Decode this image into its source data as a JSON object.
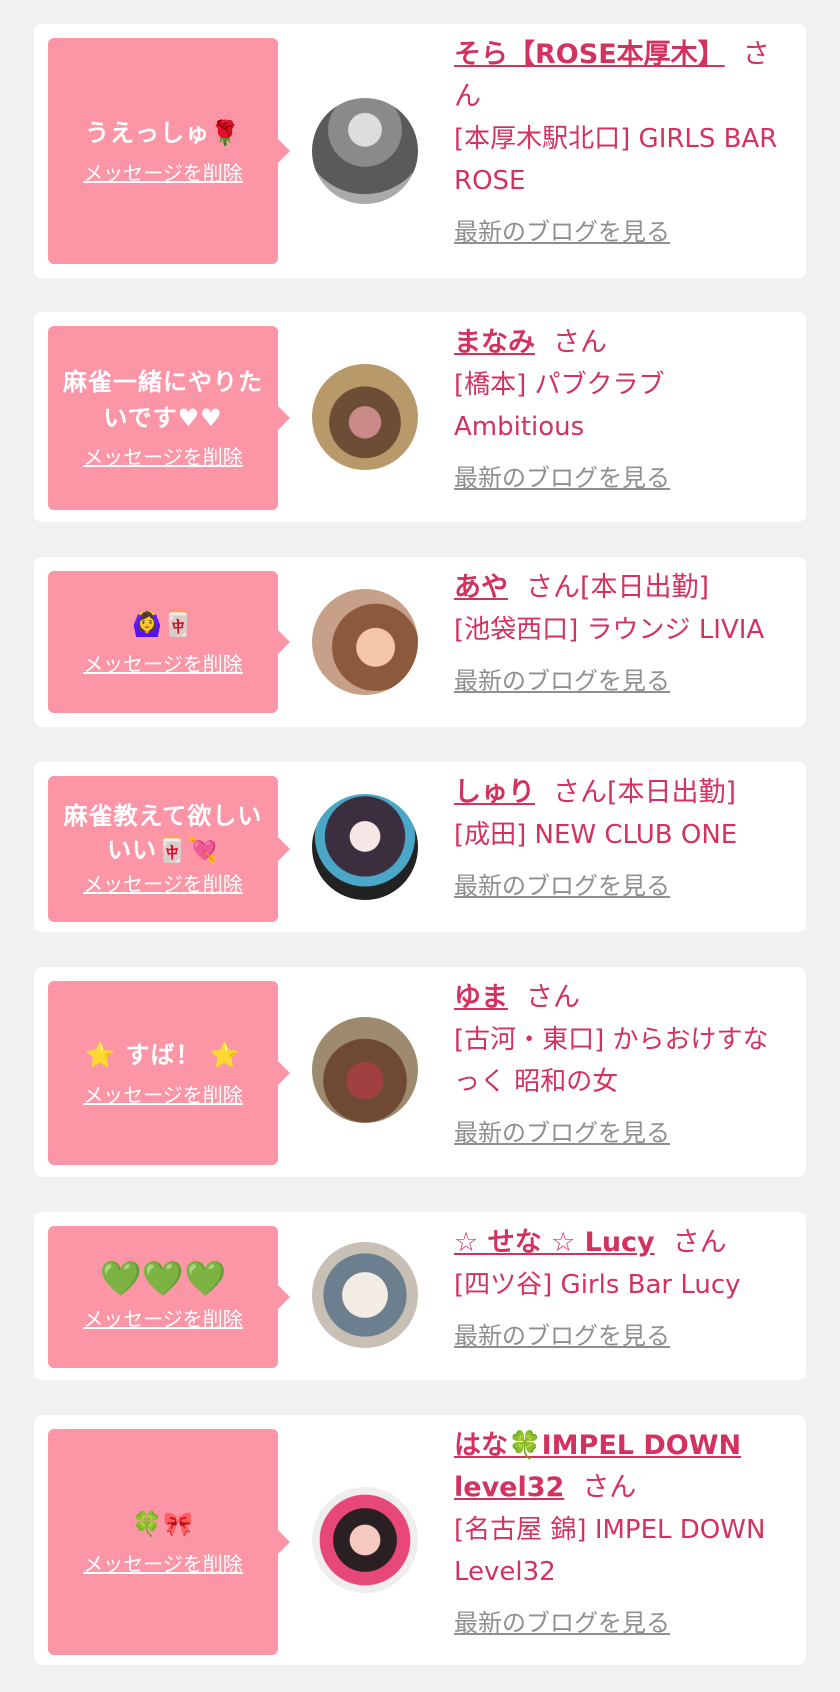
{
  "delete_label": "メッセージを削除",
  "blog_label": "最新のブログを見る",
  "san_suffix": "さん",
  "items": [
    {
      "message": "うえっしゅ",
      "message_emoji": "🌹",
      "name": "そら【ROSE本厚木】",
      "status": "",
      "shop": "[本厚木駅北口] GIRLS BAR ROSE",
      "avatar_icon": "man-in-suit-photo"
    },
    {
      "message": "麻雀一緒にやりたいです♥♥",
      "message_emoji": "",
      "name": "まなみ",
      "status": "",
      "shop": "[橋本] パブクラブ Ambitious",
      "avatar_icon": "mirror-selfie-photo"
    },
    {
      "message": "",
      "message_emoji": "🙆‍♀️🀄",
      "name": "あや",
      "status": "[本日出勤]",
      "shop": "[池袋西口] ラウンジ LIVIA",
      "avatar_icon": "woman-bunny-sticker-photo"
    },
    {
      "message": "麻雀教えて欲しいいい",
      "message_emoji": "🀄💘",
      "name": "しゅり",
      "status": "[本日出勤]",
      "shop": "[成田] NEW CLUB ONE",
      "avatar_icon": "woman-photo"
    },
    {
      "message": "すば！",
      "message_emoji": "⭐",
      "name": "ゆま",
      "status": "",
      "shop": "[古河・東口] からおけすなっく 昭和の女",
      "avatar_icon": "woman-in-bar-photo"
    },
    {
      "message": "",
      "message_emoji": "💚💚💚",
      "name": "☆ せな ☆ Lucy",
      "status": "",
      "shop": "[四ツ谷] Girls Bar Lucy",
      "avatar_icon": "plush-toy-photo"
    },
    {
      "message": "",
      "message_emoji": "🍀🎀",
      "name": "はな🍀IMPEL DOWN level32",
      "status": "",
      "shop": "[名古屋 錦] IMPEL DOWN Level32",
      "avatar_icon": "woman-logo-photo"
    }
  ],
  "colors": {
    "bubble": "#fc96a6",
    "name": "#d3325f",
    "blog": "#8f8f8f",
    "background": "#f1f1f1"
  }
}
